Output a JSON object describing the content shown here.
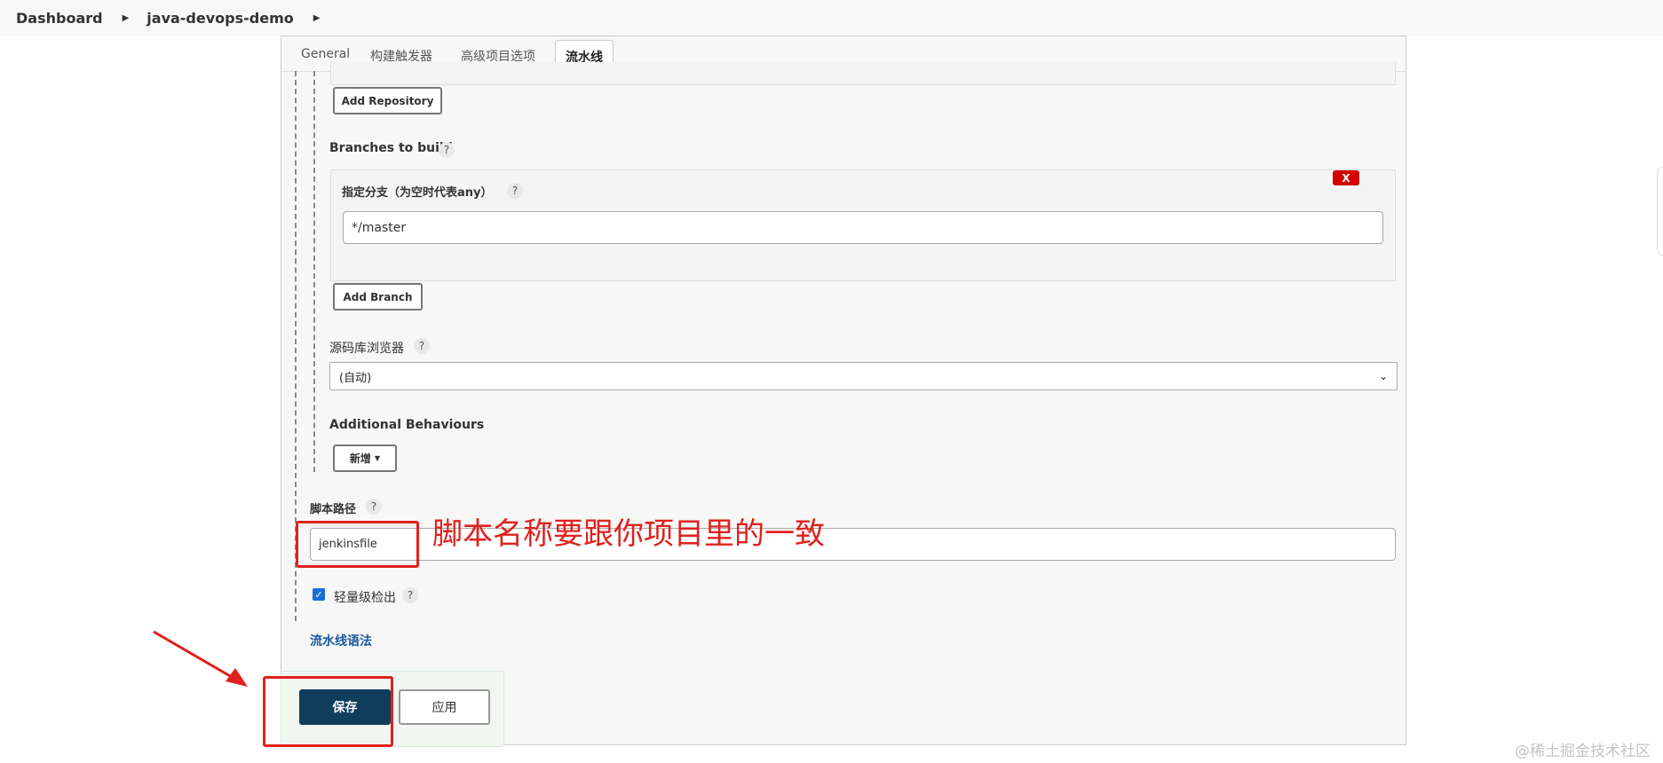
{
  "breadcrumb": {
    "items": [
      "Dashboard",
      "java-devops-demo"
    ]
  },
  "tabs": [
    "General",
    "构建触发器",
    "高级项目选项",
    "流水线"
  ],
  "scm": {
    "add_repository": "Add Repository",
    "branches_label": "Branches to build",
    "branch_specifier_label": "指定分支（为空时代表any）",
    "branch_value": "*/master",
    "delete_label": "X",
    "add_branch": "Add Branch",
    "repo_browser_label": "源码库浏览器",
    "repo_browser_value": "(自动)",
    "additional_behaviours_label": "Additional Behaviours",
    "add_new": "新增"
  },
  "script_path": {
    "label": "脚本路径",
    "value": "jenkinsfile"
  },
  "lightweight": {
    "label": "轻量级检出",
    "checked": true
  },
  "pipeline_syntax_link": "流水线语法",
  "footer": {
    "save": "保存",
    "apply": "应用"
  },
  "help_glyph": "?",
  "annotation": {
    "text": "脚本名称要跟你项目里的一致",
    "color": "#e0211d"
  },
  "watermark": "@稀土掘金技术社区"
}
